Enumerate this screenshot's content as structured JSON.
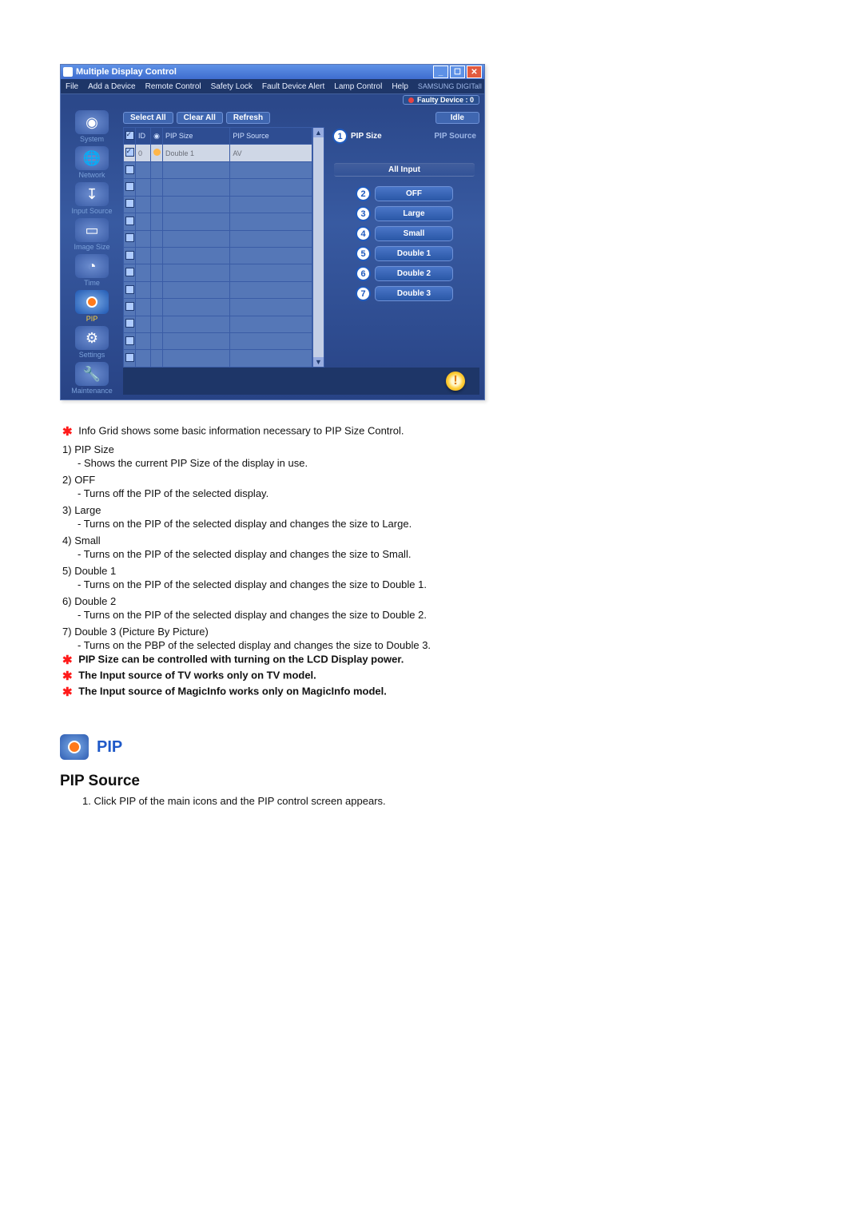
{
  "window": {
    "title": "Multiple Display Control",
    "menu": [
      "File",
      "Add a Device",
      "Remote Control",
      "Safety Lock",
      "Fault Device Alert",
      "Lamp Control",
      "Help"
    ],
    "brand": "SAMSUNG DIGITall",
    "faulty_label": "Faulty Device : 0",
    "idle_label": "Idle",
    "grid_buttons": {
      "select_all": "Select All",
      "clear_all": "Clear All",
      "refresh": "Refresh"
    },
    "grid_headers": {
      "chk": "",
      "id": "ID",
      "status": "",
      "pip_size": "PIP Size",
      "pip_source": "PIP Source"
    },
    "grid_row": {
      "id": "0",
      "pip_size": "Double 1",
      "pip_source": "AV"
    },
    "right": {
      "pip_size_label": "PIP Size",
      "pip_source_label": "PIP Source",
      "all_input": "All Input",
      "options": {
        "off": "OFF",
        "large": "Large",
        "small": "Small",
        "double1": "Double 1",
        "double2": "Double 2",
        "double3": "Double 3"
      }
    },
    "callouts": [
      "1",
      "2",
      "3",
      "4",
      "5",
      "6",
      "7"
    ],
    "sidebar": {
      "system": "System",
      "network": "Network",
      "input_source": "Input Source",
      "image_size": "Image Size",
      "time": "Time",
      "pip": "PIP",
      "settings": "Settings",
      "maintenance": "Maintenance"
    }
  },
  "explain": {
    "intro": "Info Grid shows some basic information necessary to PIP Size Control.",
    "items": [
      {
        "num": "1)",
        "title": "PIP Size",
        "desc": "- Shows the current PIP Size of the display in use."
      },
      {
        "num": "2)",
        "title": "OFF",
        "desc": "- Turns off the PIP of the selected display."
      },
      {
        "num": "3)",
        "title": "Large",
        "desc": "- Turns on the PIP of the selected display and changes the size to Large."
      },
      {
        "num": "4)",
        "title": "Small",
        "desc": "- Turns on the PIP of the selected display and changes the size to Small."
      },
      {
        "num": "5)",
        "title": "Double 1",
        "desc": "- Turns on the PIP of the selected display and changes the size to Double 1."
      },
      {
        "num": "6)",
        "title": "Double 2",
        "desc": "- Turns on the PIP of the selected display and changes the size to Double 2."
      },
      {
        "num": "7)",
        "title": "Double 3 (Picture By Picture)",
        "desc": "- Turns on the PBP of the selected display and changes the size to Double 3."
      }
    ],
    "notes": [
      "PIP Size can be controlled with turning on the LCD Display power.",
      "The Input source of TV works only on TV model.",
      "The Input source of MagicInfo works only on MagicInfo model."
    ]
  },
  "section": {
    "label": "PIP",
    "sub_title": "PIP Source",
    "step1": "Click PIP of the main icons and the PIP control screen appears."
  }
}
